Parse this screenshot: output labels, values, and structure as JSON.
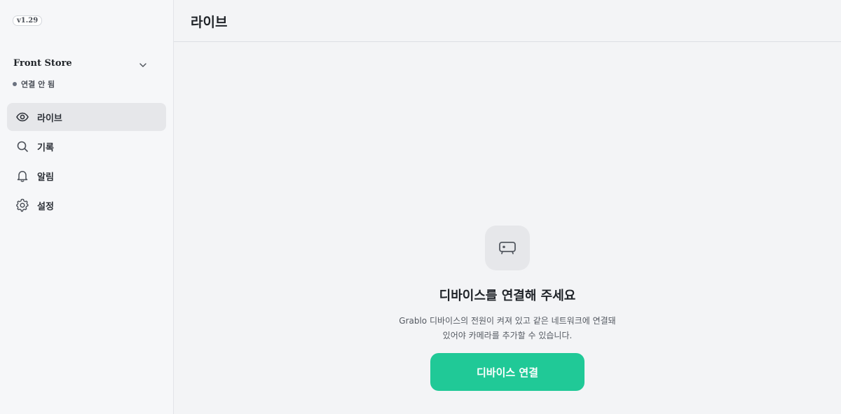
{
  "app": {
    "version": "v1.29"
  },
  "store": {
    "name": "Front Store",
    "status": "연결 안 됨"
  },
  "nav": {
    "items": [
      {
        "label": "라이브",
        "icon": "eye-icon",
        "active": true
      },
      {
        "label": "기록",
        "icon": "search-icon",
        "active": false
      },
      {
        "label": "알림",
        "icon": "bell-icon",
        "active": false
      },
      {
        "label": "설정",
        "icon": "gear-icon",
        "active": false
      }
    ]
  },
  "header": {
    "title": "라이브"
  },
  "empty_state": {
    "icon": "device-icon",
    "title": "디바이스를 연결해 주세요",
    "description_line1": "Grablo 디바이스의 전원이 켜져 있고 같은 네트워크에 연결돼",
    "description_line2": "있어야 카메라를 추가할 수 있습니다.",
    "button_label": "디바이스 연결"
  },
  "colors": {
    "accent": "#20c997",
    "sidebar_bg": "#f6f7f9",
    "main_bg": "#f3f4f6",
    "active_item_bg": "#e6e7ea"
  }
}
